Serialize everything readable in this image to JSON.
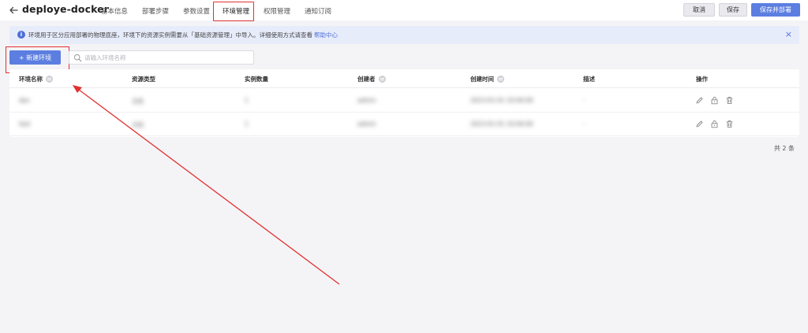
{
  "header": {
    "title": "deploye-docker",
    "tabs": [
      {
        "label": "基本信息"
      },
      {
        "label": "部署步骤"
      },
      {
        "label": "参数设置"
      },
      {
        "label": "环境管理"
      },
      {
        "label": "权限管理"
      },
      {
        "label": "通知订阅"
      }
    ],
    "active_tab": "环境管理",
    "cancel_label": "取消",
    "save_label": "保存",
    "save_deploy_label": "保存并部署"
  },
  "banner": {
    "text": "环境用于区分应用部署的物理底座，环境下的资源实例需要从「基础资源管理」中导入。详细使用方式请查看",
    "link": "帮助中心",
    "close": "×"
  },
  "toolbar": {
    "new_label": "+ 新建环境",
    "search_placeholder": "请输入环境名称"
  },
  "table": {
    "columns": [
      "环境名称",
      "资源类型",
      "实例数量",
      "创建者",
      "创建时间",
      "描述",
      "操作"
    ],
    "rows": [
      {
        "name": "dev",
        "resource_type": "主机",
        "instance_count": "1",
        "creator": "admin",
        "created_at": "2023-01-01 10:00:00",
        "description": "-"
      },
      {
        "name": "test",
        "resource_type": "主机",
        "instance_count": "1",
        "creator": "admin",
        "created_at": "2023-01-01 10:00:00",
        "description": "-"
      }
    ]
  },
  "footer": {
    "total": "共 2 条"
  },
  "icons": {
    "back": "arrow-left-icon",
    "info": "info-icon",
    "search": "search-icon",
    "edit": "pencil-icon",
    "lock": "lock-icon",
    "delete": "trash-icon"
  },
  "colors": {
    "primary": "#5b7ee0",
    "annotation": "#e23030",
    "banner_bg": "#e7ecfb"
  }
}
